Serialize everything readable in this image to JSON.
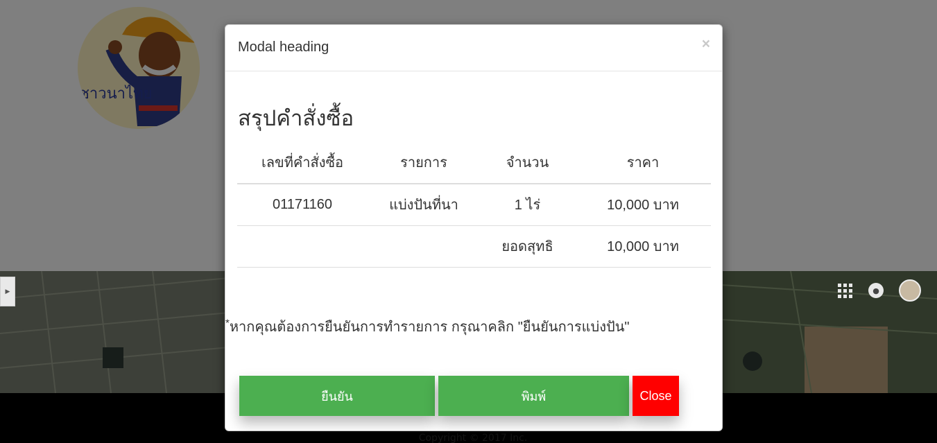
{
  "background": {
    "logo_text": "ชาวนาไทย",
    "footer_text": "Copyright © 2017 Inc."
  },
  "modal": {
    "heading": "Modal heading",
    "close_symbol": "×",
    "summary_title": "สรุปคำสั่งซื้อ",
    "table": {
      "headers": [
        "เลขที่คำสั่งซื้อ",
        "รายการ",
        "จำนวน",
        "ราคา"
      ],
      "rows": [
        [
          "01171160",
          "แบ่งปันที่นา",
          "1 ไร่",
          "10,000 บาท"
        ]
      ],
      "total": {
        "label": "ยอดสุทธิ",
        "value": "10,000 บาท"
      }
    },
    "note_mark": "*",
    "note": "หากคุณต้องการยืนยันการทำรายการ กรุณาคลิก \"ยืนยันการแบ่งปัน\"",
    "buttons": {
      "confirm": "ยืนยัน",
      "print": "พิมพ์",
      "close": "Close"
    }
  },
  "colors": {
    "confirm_button": "#4caf50",
    "print_button": "#4caf50",
    "close_button": "#ff0000",
    "backdrop": "rgba(0,0,0,0.5)"
  },
  "icons": [
    "chevron-right-icon",
    "apps-grid-icon",
    "bell-icon",
    "close-icon"
  ]
}
